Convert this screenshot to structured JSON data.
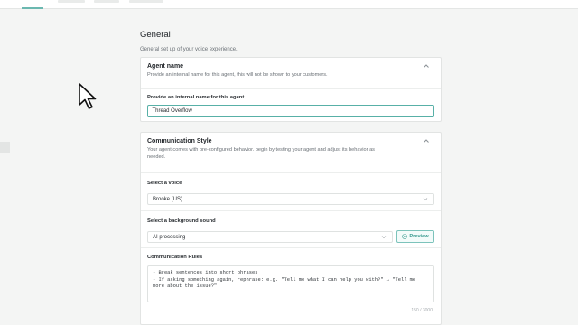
{
  "general": {
    "title": "General",
    "subtitle": "General set up of your voice experience."
  },
  "agent_name_card": {
    "title": "Agent name",
    "description": "Provide an internal name for this agent, this will not be shown to your customers.",
    "field_label": "Provide an internal name for this agent",
    "field_value": "Thread Overflow"
  },
  "communication_card": {
    "title": "Communication Style",
    "description_line1": "Your agent comes with pre-configured behavior. begin by testing your agent and adjust its behavior as",
    "description_line2": "needed.",
    "voice_label": "Select a voice",
    "voice_value": "Brooke (US)",
    "sound_label": "Select a background sound",
    "sound_value": "AI processing",
    "preview_label": "Preview",
    "rules_label": "Communication Rules",
    "rules_lines": [
      "- Break sentences into short phrases",
      "- If asking something again, rephrase: e.g. \"Tell me what I can help you with?\" → \"Tell me",
      "more about the issue?\""
    ],
    "counter": "150 / 3000"
  },
  "colors": {
    "accent": "#58b0a7",
    "background": "#f4f5f4"
  },
  "icons": [
    "chevron-up-icon",
    "chevron-down-icon",
    "play-circle-icon",
    "cursor-arrow-icon"
  ]
}
